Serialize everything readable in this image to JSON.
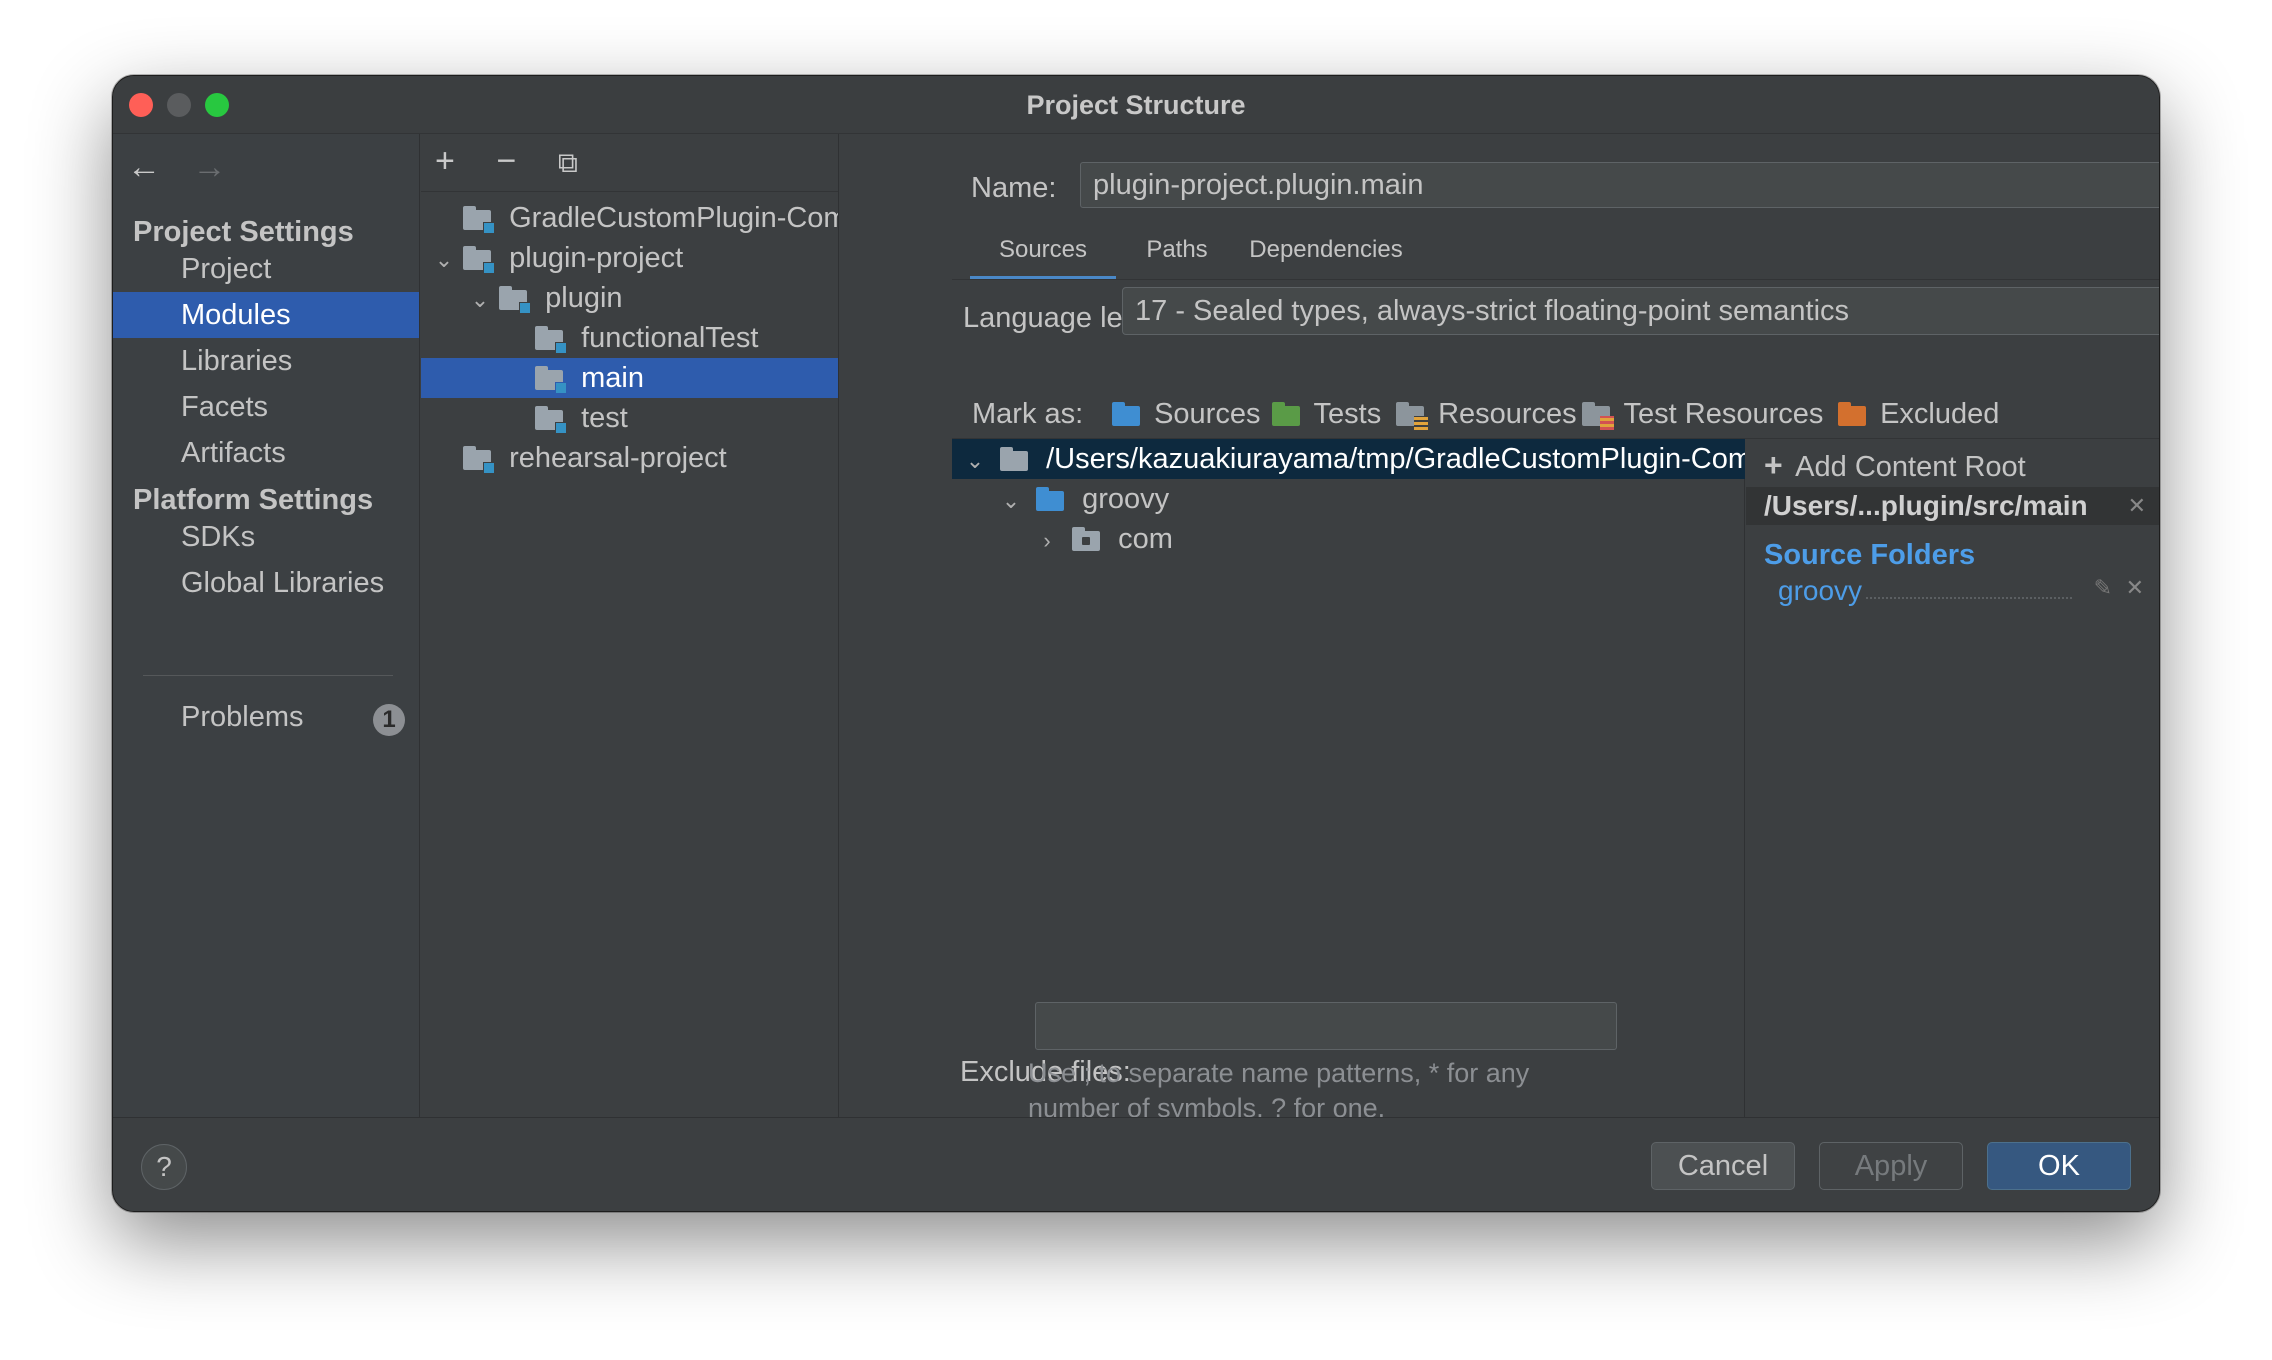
{
  "window": {
    "title": "Project Structure"
  },
  "nav": {
    "back": "←",
    "forward": "→",
    "project_settings": "Project Settings",
    "platform_settings": "Platform Settings",
    "items": [
      {
        "label": "Project"
      },
      {
        "label": "Modules",
        "selected": true
      },
      {
        "label": "Libraries"
      },
      {
        "label": "Facets"
      },
      {
        "label": "Artifacts"
      }
    ],
    "platform_items": [
      {
        "label": "SDKs"
      },
      {
        "label": "Global Libraries"
      }
    ],
    "problems": {
      "label": "Problems",
      "count": "1"
    }
  },
  "modules_toolbar": {
    "add": "+",
    "remove": "−",
    "copy": "⧉"
  },
  "module_tree": [
    {
      "label": "GradleCustomPlugin-Com",
      "chevron": ""
    },
    {
      "label": "plugin-project",
      "chevron": "⌄"
    },
    {
      "label": "plugin",
      "chevron": "⌄"
    },
    {
      "label": "functionalTest",
      "chevron": ""
    },
    {
      "label": "main",
      "chevron": "",
      "selected": true
    },
    {
      "label": "test",
      "chevron": ""
    },
    {
      "label": "rehearsal-project",
      "chevron": ""
    }
  ],
  "name_field": {
    "label": "Name:",
    "value": "plugin-project.plugin.main"
  },
  "tabs": [
    {
      "label": "Sources",
      "active": true
    },
    {
      "label": "Paths"
    },
    {
      "label": "Dependencies"
    }
  ],
  "language_level": {
    "label": "Language level:",
    "value": "17 - Sealed types, always-strict floating-point semantics"
  },
  "mark_as": {
    "label": "Mark as:",
    "items": [
      {
        "label": "Sources",
        "color": "#3f8ed2"
      },
      {
        "label": "Tests",
        "color": "#5a9b47"
      },
      {
        "label": "Resources",
        "color": "#8c959c"
      },
      {
        "label": "Test Resources",
        "color": "#8c959c"
      },
      {
        "label": "Excluded",
        "color": "#d3702e"
      }
    ]
  },
  "content_tree": [
    {
      "label": "/Users/kazuakiurayama/tmp/GradleCustomPlugin-Com",
      "chevron": "⌄",
      "selected": true
    },
    {
      "label": "groovy",
      "chevron": "⌄"
    },
    {
      "label": "com",
      "chevron": "›"
    }
  ],
  "content_roots": {
    "add_label": "Add Content Root",
    "add_icon": "+",
    "root_path": "/Users/...plugin/src/main",
    "source_folders_title": "Source Folders",
    "source_folders": [
      "groovy"
    ],
    "edit_icon": "pencil-icon",
    "remove_icon": "close-icon"
  },
  "exclude_files": {
    "label": "Exclude files:",
    "value": "",
    "hint_line1": "Use ; to separate name patterns, * for any",
    "hint_line2": "number of symbols, ? for one."
  },
  "buttons": {
    "help": "?",
    "cancel": "Cancel",
    "apply": "Apply",
    "ok": "OK"
  }
}
